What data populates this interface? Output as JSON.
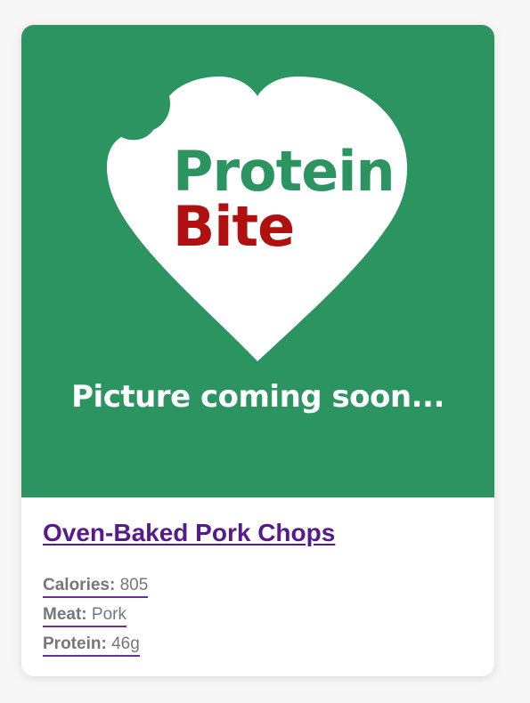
{
  "card": {
    "image": {
      "brand_word_1": "Protein",
      "brand_word_2": "Bite",
      "caption": "Picture coming soon...",
      "colors": {
        "background": "#2b9460",
        "heart": "#ffffff",
        "brand_green": "#2b9460",
        "brand_red": "#b01010"
      }
    },
    "title": "Oven-Baked Pork Chops",
    "stats": [
      {
        "label": "Calories:",
        "value": "805"
      },
      {
        "label": "Meat:",
        "value": "Pork"
      },
      {
        "label": "Protein:",
        "value": "46g"
      }
    ]
  }
}
